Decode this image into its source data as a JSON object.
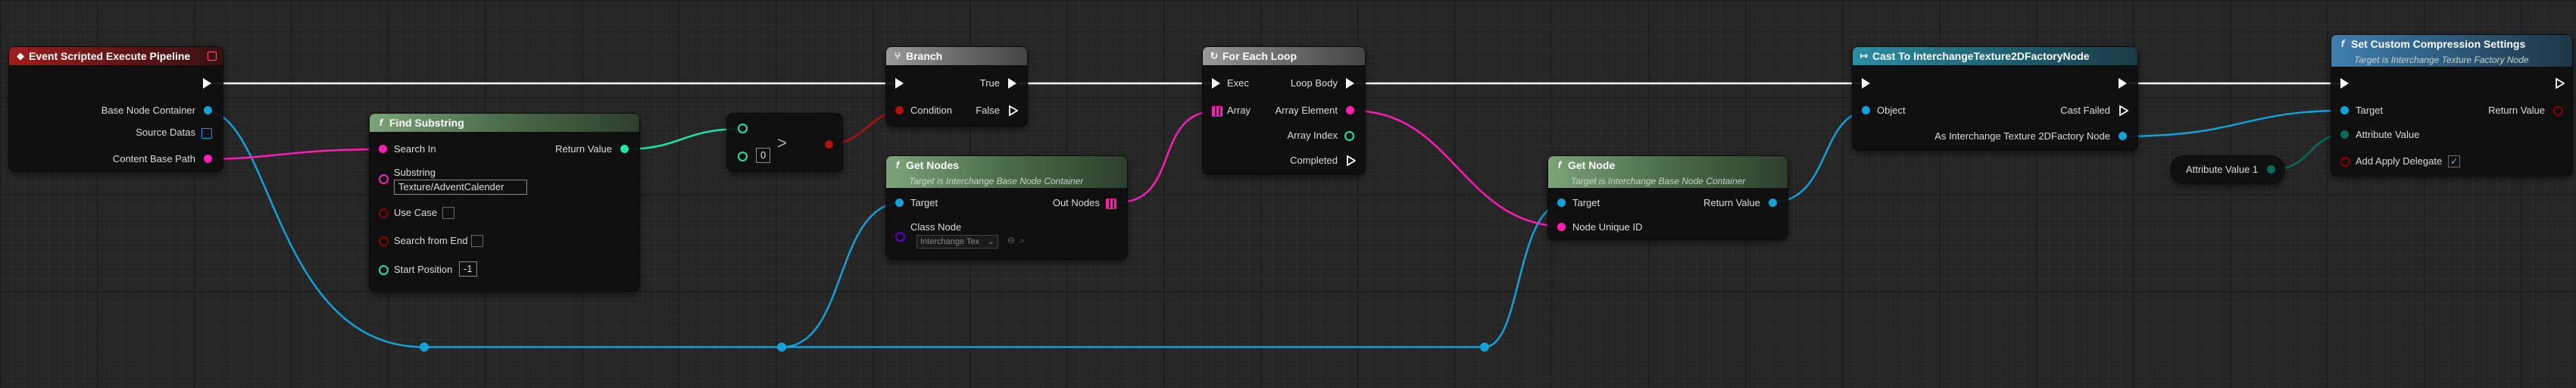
{
  "nodes": {
    "event": {
      "title": "Event Scripted Execute Pipeline",
      "pins": {
        "base_node_container": "Base Node Container",
        "source_datas": "Source Datas",
        "content_base_path": "Content Base Path"
      }
    },
    "find_substring": {
      "title": "Find Substring",
      "pins": {
        "search_in": "Search In",
        "substring": "Substring",
        "return_value": "Return Value",
        "use_case": "Use Case",
        "search_from_end": "Search from End",
        "start_position": "Start Position"
      },
      "substring_value": "Texture/AdventCalender",
      "start_position_value": "-1"
    },
    "greater": {
      "symbol": ">",
      "b_value": "0"
    },
    "branch": {
      "title": "Branch",
      "pins": {
        "true": "True",
        "condition": "Condition",
        "false": "False"
      }
    },
    "get_nodes": {
      "title": "Get Nodes",
      "subtitle": "Target is Interchange Base Node Container",
      "pins": {
        "target": "Target",
        "out_nodes": "Out Nodes",
        "class_node": "Class Node"
      },
      "class_value": "Interchange Tex"
    },
    "for_each": {
      "title": "For Each Loop",
      "pins": {
        "exec": "Exec",
        "loop_body": "Loop Body",
        "array": "Array",
        "array_element": "Array Element",
        "array_index": "Array Index",
        "completed": "Completed"
      }
    },
    "get_node": {
      "title": "Get Node",
      "subtitle": "Target is Interchange Base Node Container",
      "pins": {
        "target": "Target",
        "return_value": "Return Value",
        "node_unique_id": "Node Unique ID"
      }
    },
    "cast": {
      "title": "Cast To InterchangeTexture2DFactoryNode",
      "pins": {
        "object": "Object",
        "cast_failed": "Cast Failed",
        "as_node": "As Interchange Texture 2DFactory Node"
      }
    },
    "attribute": {
      "label": "Attribute Value 1"
    },
    "set_compression": {
      "title": "Set Custom Compression Settings",
      "subtitle": "Target is Interchange Texture Factory Node",
      "pins": {
        "target": "Target",
        "return_value": "Return Value",
        "attribute_value": "Attribute Value",
        "add_apply_delegate": "Add Apply Delegate"
      },
      "add_apply_delegate_checked": "✓"
    }
  },
  "colors": {
    "exec": "#ffffff",
    "object": "#15a0d8",
    "string": "#ff1fb4",
    "integer": "#1fe6a8",
    "boolean": "#8c0000",
    "class": "#5a00c8",
    "enum": "#0a6b5a"
  }
}
